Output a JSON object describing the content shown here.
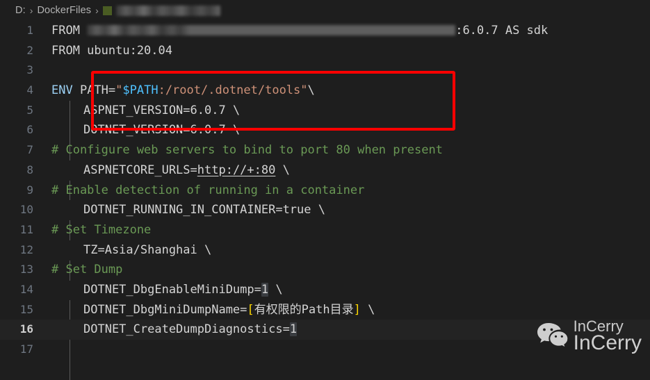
{
  "window": {
    "app": "vscode-editor",
    "background": "#1e1e1e"
  },
  "breadcrumb": {
    "drive": "D:",
    "folder": "DockerFiles",
    "separator": "›",
    "file_icon": "dockerfile-icon",
    "file_name_redacted": true,
    "file_name": ""
  },
  "colors": {
    "editor_bg": "#1e1e1e",
    "active_line_bg": "#232323",
    "line_number": "#6e7681",
    "line_number_active": "#cfcfcf",
    "text": "#d4d4d4",
    "keyword": "#9cd0f3",
    "string": "#ce9178",
    "variable": "#4fc1ff",
    "comment": "#6a9955",
    "bracket": "#ffd700",
    "match_highlight": "#3a3d41",
    "annotation_red": "#fe0000",
    "chip_green": "#4a5c23"
  },
  "editor": {
    "active_line": 16,
    "total_visible_lines": 17,
    "lines": [
      {
        "n": "1",
        "text": "FROM ██████████:6.0.7 AS sdk"
      },
      {
        "n": "2",
        "text": "FROM ubuntu:20.04"
      },
      {
        "n": "3",
        "text": ""
      },
      {
        "n": "4",
        "text": "ENV PATH=\"$PATH:/root/.dotnet/tools\"\\"
      },
      {
        "n": "5",
        "text": "    ASPNET_VERSION=6.0.7 \\"
      },
      {
        "n": "6",
        "text": "    DOTNET_VERSION=6.0.7 \\"
      },
      {
        "n": "7",
        "text": "# Configure web servers to bind to port 80 when present"
      },
      {
        "n": "8",
        "text": "    ASPNETCORE_URLS=http://+:80 \\"
      },
      {
        "n": "9",
        "text": "# Enable detection of running in a container"
      },
      {
        "n": "10",
        "text": "    DOTNET_RUNNING_IN_CONTAINER=true \\"
      },
      {
        "n": "11",
        "text": "# Set Timezone"
      },
      {
        "n": "12",
        "text": "    TZ=Asia/Shanghai \\"
      },
      {
        "n": "13",
        "text": "# Set Dump"
      },
      {
        "n": "14",
        "text": "    DOTNET_DbgEnableMiniDump=1 \\"
      },
      {
        "n": "15",
        "text": "    DOTNET_DbgMiniDumpName=[有权限的Path目录] \\"
      },
      {
        "n": "16",
        "text": "    DOTNET_CreateDumpDiagnostics=1"
      },
      {
        "n": "17",
        "text": ""
      }
    ],
    "tokens": {
      "l1_from": "FROM",
      "l1_tag": ":6.0.7 AS sdk",
      "l2": "FROM ubuntu:20.04",
      "l4_env": "ENV",
      "l4_path_key": " PATH=",
      "l4_quote_open": "\"",
      "l4_var": "$PATH",
      "l4_str_rest": ":/root/.dotnet/tools\"",
      "l4_cont": "\\",
      "l5": "ASPNET_VERSION=6.0.7 \\",
      "l6": "DOTNET_VERSION=6.0.7 \\",
      "l7": "# Configure web servers to bind to port 80 when present",
      "l8_key": "ASPNETCORE_URLS=",
      "l8_url": "http://+:80",
      "l8_cont": " \\",
      "l9": "# Enable detection of running in a container",
      "l10": "DOTNET_RUNNING_IN_CONTAINER=true \\",
      "l11": "# Set Timezone",
      "l12": "TZ=Asia/Shanghai \\",
      "l13": "# Set Dump",
      "l14_key": "DOTNET_DbgEnableMiniDump=",
      "l14_val": "1",
      "l14_cont": " \\",
      "l15_key": "DOTNET_DbgMiniDumpName=",
      "l15_br_open": "[",
      "l15_val": "有权限的Path目录",
      "l15_br_close": "]",
      "l15_cont": " \\",
      "l16_key": "DOTNET_CreateDumpDiagnostics=",
      "l16_val": "1"
    }
  },
  "annotation": {
    "type": "red-rectangle",
    "covers_lines": [
      14,
      15,
      16
    ],
    "color": "#fe0000"
  },
  "watermark": {
    "icon": "wechat-icon",
    "line1": "InCerry",
    "line2": "InCerry"
  }
}
